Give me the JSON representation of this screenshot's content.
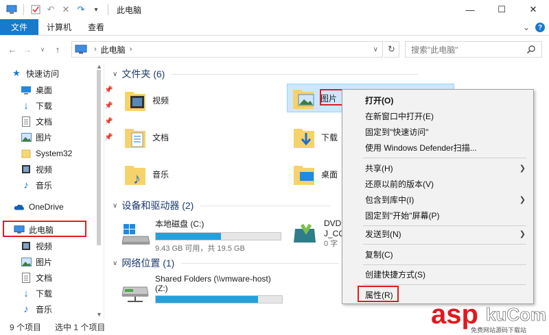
{
  "titlebar": {
    "title": "此电脑",
    "dropdown": "▾",
    "buttons": {
      "minimize": "—",
      "maximize": "☐",
      "close": "✕"
    }
  },
  "ribbon": {
    "tabs": [
      "文件",
      "计算机",
      "查看"
    ],
    "expand": "⌄",
    "help": "?"
  },
  "address": {
    "path": "此电脑",
    "search_placeholder": "搜索\"此电脑\""
  },
  "sidebar": {
    "quick_access": "快速访问",
    "items": [
      {
        "label": "桌面",
        "icon": "desktop-icon",
        "pinned": true
      },
      {
        "label": "下载",
        "icon": "download-icon",
        "pinned": true
      },
      {
        "label": "文档",
        "icon": "document-icon",
        "pinned": true
      },
      {
        "label": "图片",
        "icon": "picture-icon",
        "pinned": true
      },
      {
        "label": "System32",
        "icon": "folder-icon",
        "pinned": false
      },
      {
        "label": "视频",
        "icon": "video-icon",
        "pinned": false
      },
      {
        "label": "音乐",
        "icon": "music-icon",
        "pinned": false
      }
    ],
    "onedrive": "OneDrive",
    "this_pc": "此电脑",
    "pc_items": [
      {
        "label": "视频",
        "icon": "video-icon"
      },
      {
        "label": "图片",
        "icon": "picture-icon"
      },
      {
        "label": "文档",
        "icon": "document-icon"
      },
      {
        "label": "下载",
        "icon": "download-icon"
      },
      {
        "label": "音乐",
        "icon": "music-icon"
      }
    ]
  },
  "main": {
    "folders_header": "文件夹 (6)",
    "folders": [
      "视频",
      "图片",
      "文档",
      "下载",
      "音乐",
      "桌面"
    ],
    "devices_header": "设备和驱动器 (2)",
    "local_disk": {
      "name": "本地磁盘 (C:)",
      "info": "9.43 GB 可用，共 19.5 GB",
      "used_fraction": 0.52
    },
    "dvd": {
      "line1": "DVD",
      "line2": "J_CC",
      "line3": "0 字"
    },
    "network_header": "网络位置 (1)",
    "shared": {
      "name": "Shared Folders (\\\\vmware-host)",
      "drive": "(Z:)",
      "used_fraction": 0.81
    }
  },
  "status": {
    "count": "9 个项目",
    "selected": "选中 1 个项目"
  },
  "context_menu": {
    "items": [
      {
        "label": "打开(O)",
        "bold": true
      },
      {
        "label": "在新窗口中打开(E)"
      },
      {
        "label": "固定到\"快速访问\""
      },
      {
        "label": "使用 Windows Defender扫描..."
      },
      {
        "label": "共享(H)",
        "submenu": true
      },
      {
        "label": "还原以前的版本(V)"
      },
      {
        "label": "包含到库中(I)",
        "submenu": true
      },
      {
        "label": "固定到\"开始\"屏幕(P)"
      },
      {
        "label": "发送到(N)",
        "submenu": true
      },
      {
        "label": "复制(C)"
      },
      {
        "label": "创建快捷方式(S)"
      },
      {
        "label": "属性(R)"
      }
    ]
  },
  "watermark": {
    "brand": "asp",
    "brand2": "kuCom",
    "tagline": "免费网站源码下载站"
  },
  "colors": {
    "accent": "#1979ca",
    "highlight_red": "#e01b24",
    "progress": "#26a0da",
    "watermark_red": "#e0191f"
  }
}
